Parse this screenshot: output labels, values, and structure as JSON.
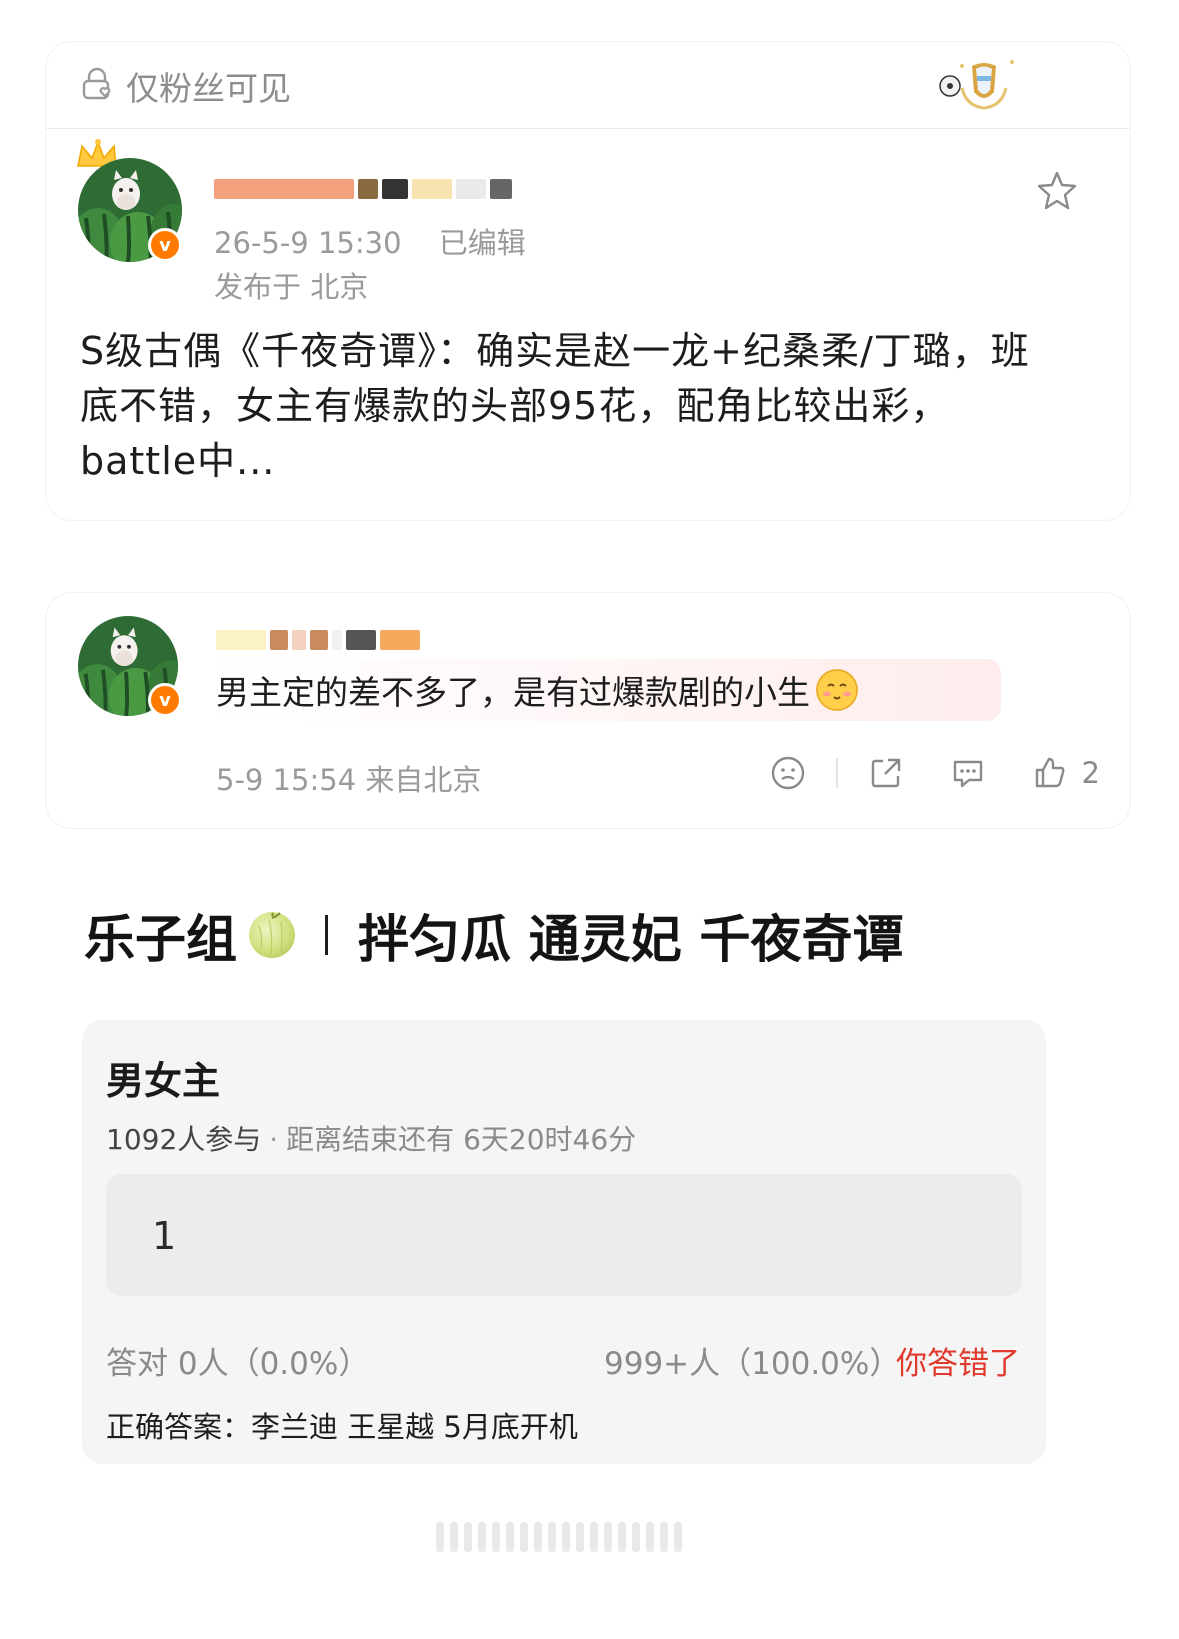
{
  "post": {
    "visibility_label": "仅粉丝可见",
    "timestamp": "26-5-9 15:30",
    "edited_label": "已编辑",
    "location": "发布于 北京",
    "content": "S级古偶《千夜奇谭》：确实是赵一龙+纪桑柔/丁璐，班底不错，女主有爆款的头部95花，配角比较出彩，battle中..."
  },
  "reply": {
    "text": "男主定的差不多了，是有过爆款剧的小生",
    "meta": "5-9 15:54  来自北京",
    "like_count": "2"
  },
  "group": {
    "name": "乐子组",
    "tags": "拌匀瓜 通灵妃 千夜奇谭"
  },
  "quiz": {
    "title": "男女主",
    "participants": "1092人参与",
    "remaining": "距离结束还有 6天20时46分",
    "option_text": "1",
    "correct_stat": "答对  0人（0.0%）",
    "other_stat": "999+人（100.0%）",
    "result_label": "你答错了",
    "answer": "正确答案：李兰迪 王星越 5月底开机"
  },
  "colors": {
    "accent_red": "#e03a2f",
    "verified_orange": "#ff7a00",
    "muted_text": "#9a9a9a"
  },
  "icons": [
    "lock-heart-icon",
    "badge-icon",
    "star-icon",
    "emoji-face-icon",
    "share-icon",
    "comment-icon",
    "like-icon",
    "melon-icon"
  ]
}
